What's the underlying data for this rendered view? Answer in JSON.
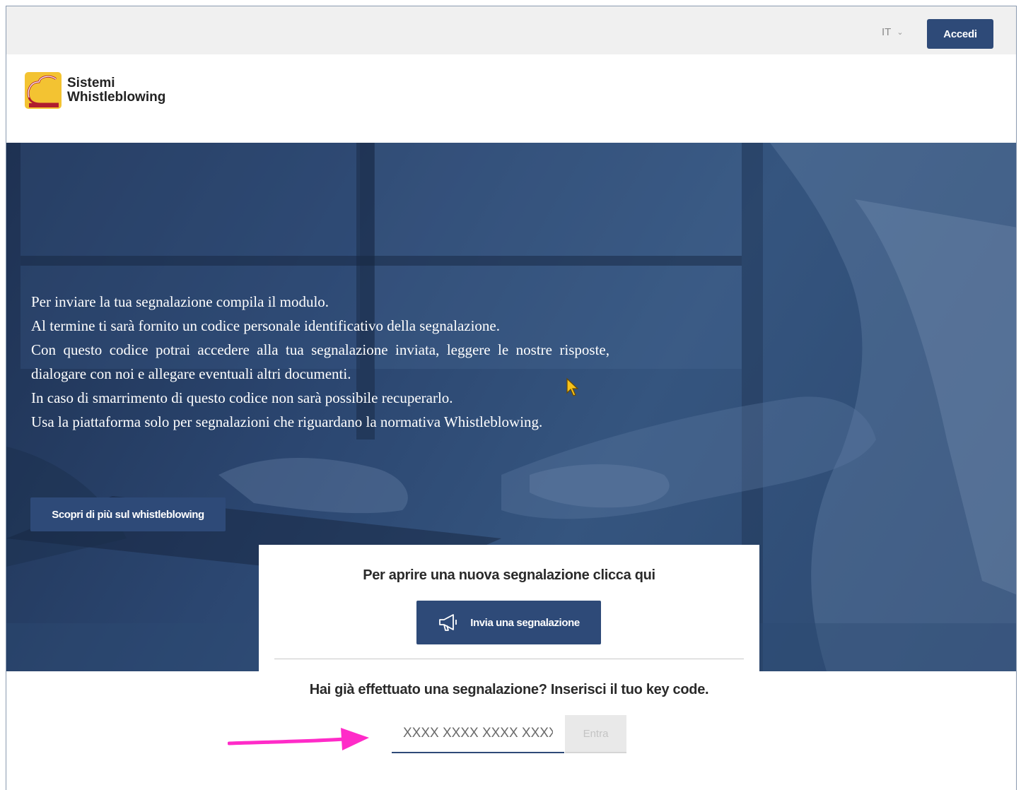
{
  "topbar": {
    "language": "IT",
    "login_label": "Accedi"
  },
  "brand": {
    "line1": "Sistemi",
    "line2": "Whistleblowing"
  },
  "hero": {
    "lines": [
      "Per inviare la tua segnalazione compila il modulo.",
      "Al termine ti sarà  fornito un codice personale identificativo della segnalazione.",
      "Con questo codice potrai accedere alla tua segnalazione inviata, leggere le nostre risposte, dialogare con noi e allegare eventuali altri documenti.",
      "In caso di smarrimento di questo codice non sarà  possibile recuperarlo.",
      "Usa la piattaforma solo per segnalazioni che riguardano la normativa Whistleblowing."
    ],
    "learn_more_label": "Scopri di più sul whistleblowing"
  },
  "card": {
    "new_report_title": "Per aprire una nuova segnalazione clicca qui",
    "send_report_label": "Invia una segnalazione",
    "existing_report_title": "Hai già effettuato una segnalazione? Inserisci il tuo key code.",
    "key_code_placeholder": "XXXX XXXX XXXX XXXX",
    "enter_label": "Entra"
  },
  "colors": {
    "primary": "#2e4a78",
    "hero_overlay": "#2b4670",
    "annotation_arrow": "#ff2bc8"
  }
}
